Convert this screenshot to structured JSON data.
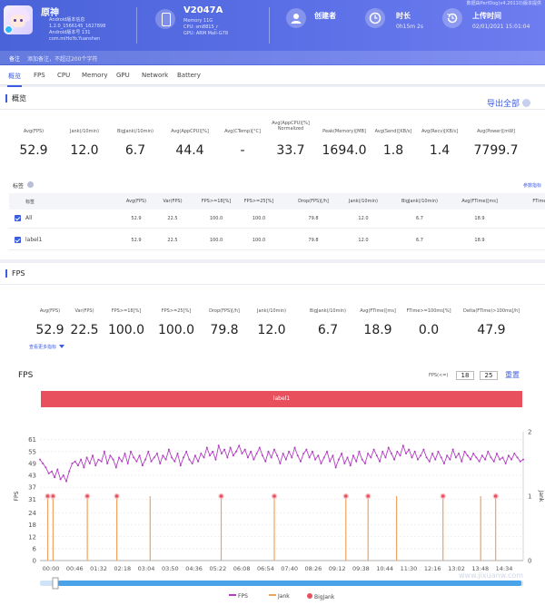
{
  "header": {
    "app_name": "原神",
    "app_meta": [
      "Android版本信息",
      "1.2.0_1566145_1627898",
      "Android版本号 131",
      "com.miHoYo.Yuanshen"
    ],
    "device_name": "V2047A",
    "device_info": [
      "Memory 11G",
      "CPU: sm8815_r",
      "GPU: ARM Mali-G78"
    ],
    "creator_label": "创建者",
    "duration_label": "时长",
    "duration_value": "0h15m 2s",
    "upload_label": "上传时间",
    "upload_value": "02/01/2021 15:01:04",
    "top_tag": "数据由PerfDog(v4.20110)版本提供",
    "note_label": "备注",
    "note_placeholder": "添加备注，不超过200个字符"
  },
  "tabs": [
    "概览",
    "FPS",
    "CPU",
    "Memory",
    "GPU",
    "Network",
    "Battery"
  ],
  "overview": {
    "title": "概览",
    "export_label": "导出全部",
    "stats": [
      {
        "label": "Avg(FPS)",
        "value": "52.9"
      },
      {
        "label": "Jank(/10min)",
        "value": "12.0"
      },
      {
        "label": "BigJank(/10min)",
        "value": "6.7"
      },
      {
        "label": "Avg(AppCPU)[%]",
        "value": "44.4"
      },
      {
        "label": "Avg(CTemp)[°C]",
        "value": "-"
      },
      {
        "label": "Avg(AppCPU)[%] Normalized",
        "value": "33.7"
      },
      {
        "label": "Peak(Memory)[MB]",
        "value": "1694.0"
      },
      {
        "label": "Avg(Send)[KB/s]",
        "value": "1.8"
      },
      {
        "label": "Avg(Recv)[KB/s]",
        "value": "1.4"
      },
      {
        "label": "Avg(Power)[mW]",
        "value": "7799.7"
      }
    ],
    "table_label": "标签",
    "table_link": "参数指标",
    "columns": [
      "标签",
      "Avg(FPS)",
      "Var(FPS)",
      "FPS>=18[%]",
      "FPS>=25[%]",
      "Drop(FPS)[/h]",
      "Jank(/10min)",
      "BigJank(/10min)",
      "Avg(FTime)[ms]",
      "FTime>"
    ],
    "rows": [
      {
        "name": "All",
        "cells": [
          "52.9",
          "22.5",
          "100.0",
          "100.0",
          "79.8",
          "12.0",
          "6.7",
          "18.9"
        ]
      },
      {
        "name": "label1",
        "cells": [
          "52.9",
          "22.5",
          "100.0",
          "100.0",
          "79.8",
          "12.0",
          "6.7",
          "18.9"
        ]
      }
    ]
  },
  "fps_section": {
    "title": "FPS",
    "stats": [
      {
        "label": "Avg(FPS)",
        "value": "52.9"
      },
      {
        "label": "Var(FPS)",
        "value": "22.5"
      },
      {
        "label": "FPS>=18[%]",
        "value": "100.0"
      },
      {
        "label": "FPS>=25[%]",
        "value": "100.0"
      },
      {
        "label": "Drop(FPS)[/h]",
        "value": "79.8"
      },
      {
        "label": "Jank(/10min)",
        "value": "12.0"
      },
      {
        "label": "BigJank(/10min)",
        "value": "6.7"
      },
      {
        "label": "Avg(FTime)[ms]",
        "value": "18.9"
      },
      {
        "label": "FTime>=100ms[%]",
        "value": "0.0"
      },
      {
        "label": "Delta(FTime)>100ms[/h]",
        "value": "47.9"
      }
    ],
    "more_link": "查看更多指标",
    "chart_title": "FPS",
    "fps_filter_label": "FPS(<=)",
    "fps_filter_values": [
      "18",
      "25"
    ],
    "reset_label": "重置",
    "label_bar": "label1",
    "legend": [
      "FPS",
      "Jank",
      "BigJank"
    ],
    "watermark": "www.jixuanw.com"
  },
  "chart_data": {
    "type": "line",
    "title": "FPS",
    "ylabel": "FPS",
    "y2label": "Jank",
    "ylim": [
      0,
      65
    ],
    "y2lim": [
      0,
      2
    ],
    "y_ticks": [
      0,
      6,
      12,
      18,
      24,
      31,
      37,
      43,
      49,
      55,
      61
    ],
    "y2_ticks": [
      0,
      1,
      2
    ],
    "x_ticks": [
      "00:00",
      "00:46",
      "01:32",
      "02:18",
      "03:04",
      "03:50",
      "04:36",
      "05:22",
      "06:08",
      "06:54",
      "07:40",
      "08:26",
      "09:12",
      "09:38",
      "10:44",
      "11:30",
      "12:16",
      "13:02",
      "13:48",
      "14:34"
    ],
    "grid": true,
    "series": [
      {
        "name": "FPS",
        "color": "#b23fc1",
        "values": [
          51,
          49,
          47,
          44,
          45,
          42,
          46,
          41,
          43,
          40,
          45,
          49,
          50,
          48,
          51,
          47,
          52,
          49,
          53,
          48,
          51,
          50,
          55,
          49,
          53,
          51,
          47,
          52,
          50,
          54,
          49,
          55,
          52,
          50,
          53,
          48,
          51,
          55,
          50,
          52,
          54,
          49,
          53,
          51,
          56,
          52,
          50,
          54,
          48,
          52,
          55,
          51,
          49,
          53,
          50,
          54,
          52,
          57,
          53,
          55,
          51,
          58,
          54,
          56,
          52,
          57,
          53,
          55,
          58,
          54,
          56,
          52,
          55,
          51,
          54,
          57,
          53,
          50,
          55,
          52,
          56,
          53,
          49,
          54,
          51,
          55,
          52,
          57,
          53,
          50,
          54,
          56,
          52,
          55,
          51,
          53,
          49,
          52,
          55,
          50,
          53,
          47,
          51,
          54,
          49,
          52,
          48,
          53,
          50,
          55,
          51,
          49,
          54,
          52,
          56,
          53,
          50,
          55,
          52,
          57,
          54,
          51,
          55,
          53,
          58,
          54,
          56,
          52,
          55,
          51,
          53,
          56,
          52,
          50,
          54,
          51,
          55,
          52,
          49,
          53,
          51,
          56,
          52,
          54,
          50,
          55,
          53,
          51,
          54,
          52,
          50,
          53,
          51,
          55,
          52,
          50,
          54,
          51,
          52,
          49,
          53,
          51,
          54,
          52,
          50,
          51
        ]
      },
      {
        "name": "Jank",
        "color": "#f0a35e",
        "values": [
          0.016,
          0.027,
          0.098,
          0.159,
          0.228,
          0.375,
          0.485,
          0.633,
          0.679,
          0.738,
          0.834,
          0.912,
          0.943
        ]
      },
      {
        "name": "BigJank",
        "color": "#e9505d",
        "values": [
          0.016,
          0.027,
          0.098,
          0.159,
          0.375,
          0.485,
          0.633,
          0.679,
          0.834,
          0.943
        ]
      }
    ]
  },
  "colors": {
    "accent": "#3d5ce0",
    "header": "#4a63d8",
    "label_bar": "#e9505d",
    "fps_line": "#b23fc1",
    "jank": "#f0a35e"
  }
}
